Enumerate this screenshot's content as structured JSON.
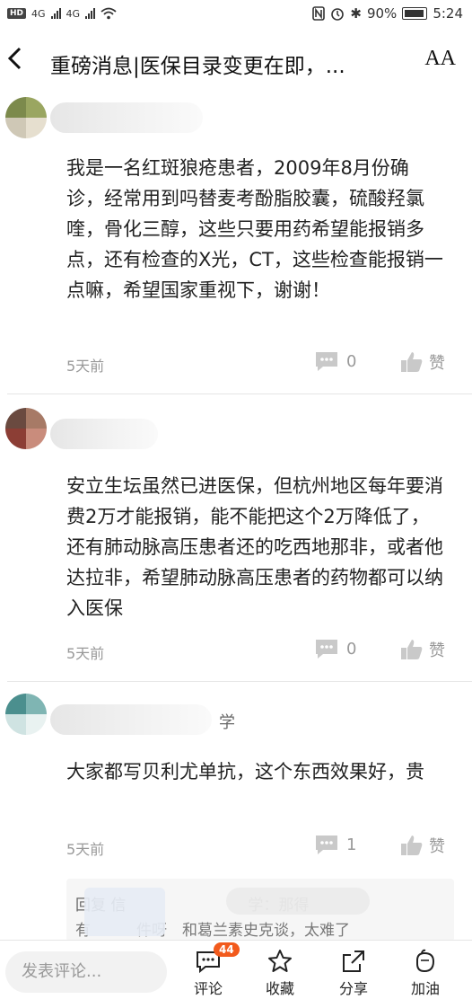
{
  "status_bar": {
    "hd": "HD",
    "net1": "4G",
    "net2": "4G",
    "battery": "90%",
    "time": "5:24"
  },
  "header": {
    "title": "重磅消息|医保目录变更在即，...",
    "font_icon": "AA"
  },
  "comments": [
    {
      "text": "我是一名红斑狼疮患者，2009年8月份确诊，经常用到吗替麦考酚脂胶囊，硫酸羟氯喹，骨化三醇，这些只要用药希望能报销多点，还有检查的X光，CT，这些检查能报销一点嘛，希望国家重视下，谢谢！",
      "time": "5天前",
      "comment_count": "0",
      "like_label": "赞"
    },
    {
      "text": "安立生坛虽然已进医保，但杭州地区每年要消费2万才能报销，能不能把这个2万降低了，还有肺动脉高压患者还的吃西地那非，或者他达拉非，希望肺动脉高压患者的药物都可以纳入医保",
      "time": "5天前",
      "comment_count": "0",
      "like_label": "赞"
    },
    {
      "name_suffix": "学",
      "text": "大家都写贝利尤单抗，这个东西效果好，贵",
      "time": "5天前",
      "comment_count": "1",
      "like_label": "赞"
    }
  ],
  "reply": {
    "line1": "回复 信　　　　　　　　学：那得",
    "line2": "有　　　件呀　和葛兰素史克谈，太难了"
  },
  "bottom_bar": {
    "input_placeholder": "发表评论...",
    "comment_label": "评论",
    "comment_badge": "44",
    "favorite_label": "收藏",
    "share_label": "分享",
    "cheer_label": "加油"
  }
}
